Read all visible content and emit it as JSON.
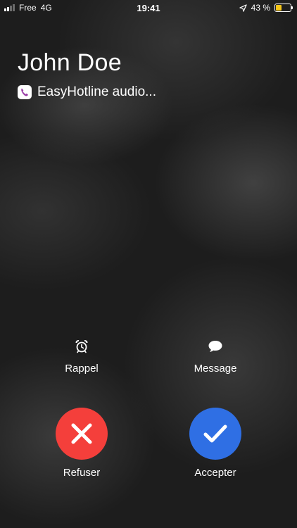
{
  "status_bar": {
    "carrier": "Free",
    "network": "4G",
    "time": "19:41",
    "battery_percent": "43 %",
    "battery_level": 0.43,
    "signal_bars_active": 2,
    "signal_bars_total": 4
  },
  "call": {
    "caller_name": "John Doe",
    "app_name": "EasyHotline audio..."
  },
  "actions": {
    "reminder_label": "Rappel",
    "message_label": "Message",
    "decline_label": "Refuser",
    "accept_label": "Accepter"
  },
  "colors": {
    "decline": "#f43f3b",
    "accept": "#2f6fe4",
    "battery": "#f5c518",
    "app_icon_accent": "#9b3fa8"
  },
  "icons": {
    "reminder": "alarm-clock-icon",
    "message": "speech-bubble-icon",
    "decline": "x-mark-icon",
    "accept": "checkmark-icon",
    "location": "location-arrow-icon",
    "app": "phone-handset-icon"
  }
}
